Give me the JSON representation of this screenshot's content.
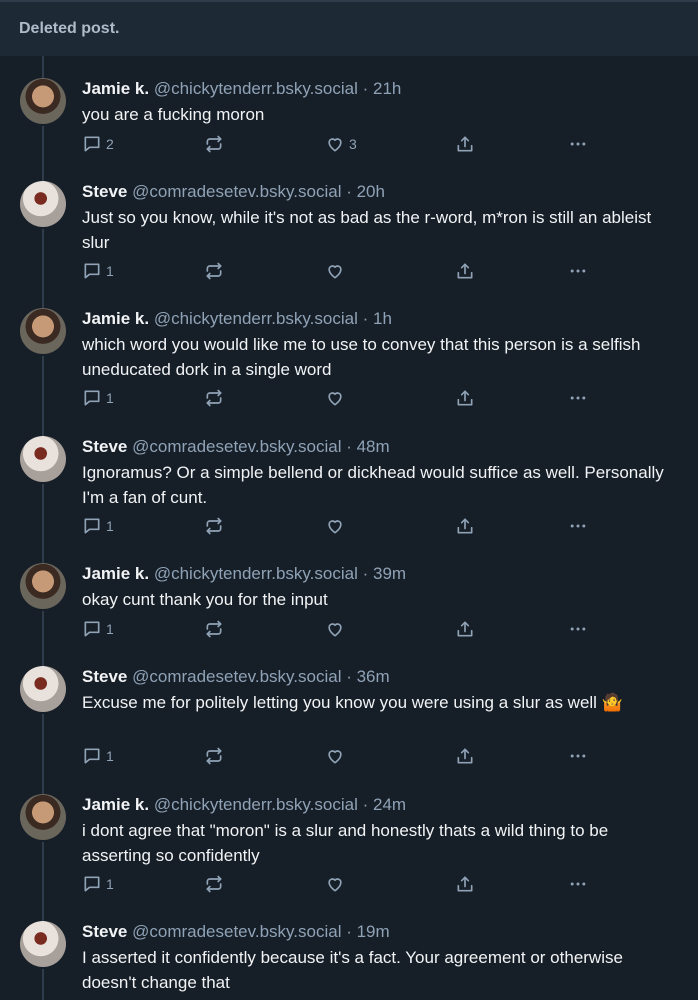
{
  "deleted_notice": "Deleted post.",
  "posts": [
    {
      "name": "Jamie k.",
      "handle": "@chickytenderr.bsky.social",
      "time": "21h",
      "text": "you are a fucking moron",
      "replies": "2",
      "likes": "3"
    },
    {
      "name": "Steve",
      "handle": "@comradesetev.bsky.social",
      "time": "20h",
      "text": "Just so you know, while it's not as bad as the r-word, m*ron is still an ableist slur",
      "replies": "1",
      "likes": ""
    },
    {
      "name": "Jamie k.",
      "handle": "@chickytenderr.bsky.social",
      "time": "1h",
      "text": "which word you would like me to use to convey that this person is a selfish uneducated dork in a single word",
      "replies": "1",
      "likes": ""
    },
    {
      "name": "Steve",
      "handle": "@comradesetev.bsky.social",
      "time": "48m",
      "text": "Ignoramus? Or a simple bellend or dickhead would suffice as well. Personally I'm a fan of cunt.",
      "replies": "1",
      "likes": ""
    },
    {
      "name": "Jamie k.",
      "handle": "@chickytenderr.bsky.social",
      "time": "39m",
      "text": "okay cunt thank you for the input",
      "replies": "1",
      "likes": ""
    },
    {
      "name": "Steve",
      "handle": "@comradesetev.bsky.social",
      "time": "36m",
      "text": "Excuse me for politely letting you know you were using a slur as well 🤷",
      "replies": "1",
      "likes": ""
    },
    {
      "name": "Jamie k.",
      "handle": "@chickytenderr.bsky.social",
      "time": "24m",
      "text": "i dont agree that \"moron\" is a slur and honestly thats a wild thing to be asserting so confidently",
      "replies": "1",
      "likes": ""
    },
    {
      "name": "Steve",
      "handle": "@comradesetev.bsky.social",
      "time": "19m",
      "text": "I asserted it confidently because it's a fact. Your agreement or otherwise doesn't change that",
      "replies": "",
      "likes": ""
    }
  ],
  "separator": " · "
}
